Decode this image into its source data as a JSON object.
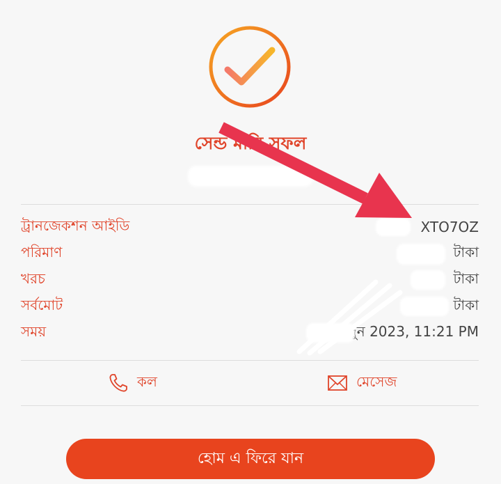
{
  "title": "সেন্ড মানি সফল",
  "details": [
    {
      "label": "ট্রানজেকশন আইডি",
      "value": "XTO7OZ"
    },
    {
      "label": "পরিমাণ",
      "value": "টাকা"
    },
    {
      "label": "খরচ",
      "value": "টাকা"
    },
    {
      "label": "সর্বমোট",
      "value": "টাকা"
    },
    {
      "label": "সময়",
      "value": "জুন 2023, 11:21 PM"
    }
  ],
  "actions": {
    "call_label": "কল",
    "message_label": "মেসেজ"
  },
  "home_button_label": "হোম এ ফিরে যান",
  "icons": {
    "success": "checkmark-circle-icon",
    "call": "phone-icon",
    "message": "envelope-icon",
    "annotation": "red-arrow-annotation"
  },
  "colors": {
    "accent": "#e0442a",
    "button": "#e8441e",
    "arrow": "#e8344e",
    "background": "#f7f7f7"
  }
}
